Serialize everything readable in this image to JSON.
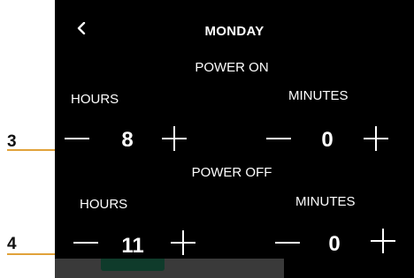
{
  "screen": {
    "title": "MONDAY",
    "back_icon": "chevron-left-icon"
  },
  "power_on": {
    "label": "POWER ON",
    "hours_label": "HOURS",
    "minutes_label": "MINUTES",
    "hours_value": "8",
    "minutes_value": "0"
  },
  "power_off": {
    "label": "POWER OFF",
    "hours_label": "HOURS",
    "minutes_label": "MINUTES",
    "hours_value": "11",
    "minutes_value": "0"
  },
  "callouts": [
    "3",
    "4"
  ],
  "colors": {
    "screen_bg": "#000000",
    "text": "#ffffff",
    "callout_line": "#e1a23a",
    "bottom_bar": "#3a3a3a",
    "bottom_tab": "#0f3b2b"
  }
}
